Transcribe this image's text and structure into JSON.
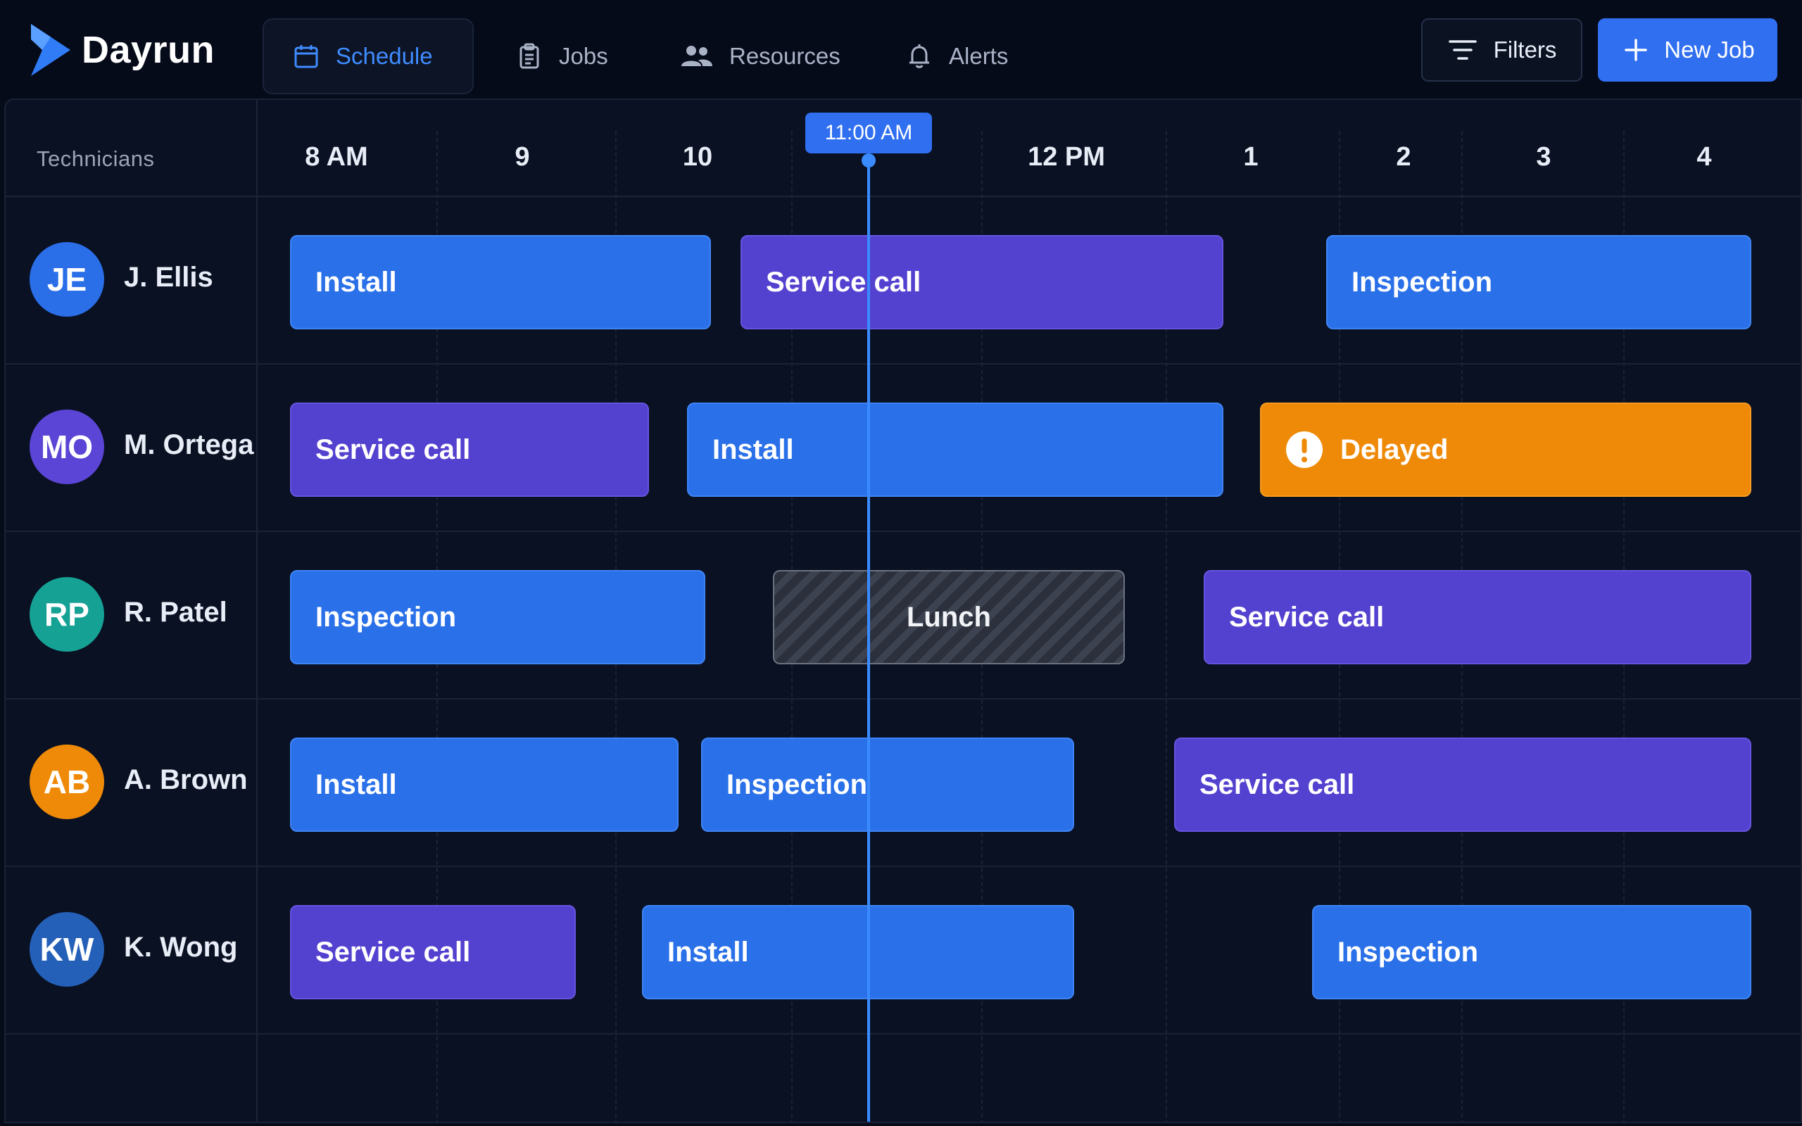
{
  "app": {
    "name": "Dayrun"
  },
  "nav": {
    "tabs": [
      {
        "label": "Schedule",
        "icon": "calendar-icon",
        "active": true
      },
      {
        "label": "Jobs",
        "icon": "clipboard-icon",
        "active": false
      },
      {
        "label": "Resources",
        "icon": "people-icon",
        "active": false
      },
      {
        "label": "Alerts",
        "icon": "bell-icon",
        "active": false
      }
    ]
  },
  "toolbar": {
    "filters_label": "Filters",
    "new_job_label": "New Job"
  },
  "schedule": {
    "column_header": "Technicians",
    "hours": [
      "8 AM",
      "9",
      "10",
      "12 PM",
      "1",
      "2",
      "3",
      "4"
    ],
    "current_time_label": "11:00 AM",
    "technicians": [
      {
        "initials": "JE",
        "name": "J. Ellis",
        "avatar_color": "#2a6ee8",
        "jobs": [
          {
            "label": "Install",
            "kind": "install"
          },
          {
            "label": "Service call",
            "kind": "service"
          },
          {
            "label": "Inspection",
            "kind": "inspection"
          }
        ]
      },
      {
        "initials": "MO",
        "name": "M. Ortega",
        "avatar_color": "#5b45d6",
        "jobs": [
          {
            "label": "Service call",
            "kind": "service"
          },
          {
            "label": "Install",
            "kind": "install"
          },
          {
            "label": "Delayed",
            "kind": "delayed",
            "icon": "alert-icon"
          }
        ]
      },
      {
        "initials": "RP",
        "name": "R. Patel",
        "avatar_color": "#16a195",
        "jobs": [
          {
            "label": "Inspection",
            "kind": "inspection"
          },
          {
            "label": "Lunch",
            "kind": "lunch"
          },
          {
            "label": "Service call",
            "kind": "service"
          }
        ]
      },
      {
        "initials": "AB",
        "name": "A. Brown",
        "avatar_color": "#ef8a08",
        "jobs": [
          {
            "label": "Install",
            "kind": "install"
          },
          {
            "label": "Inspection",
            "kind": "inspection"
          },
          {
            "label": "Service call",
            "kind": "service"
          }
        ]
      },
      {
        "initials": "KW",
        "name": "K. Wong",
        "avatar_color": "#2560b8",
        "jobs": [
          {
            "label": "Service call",
            "kind": "service"
          },
          {
            "label": "Install",
            "kind": "install"
          },
          {
            "label": "Inspection",
            "kind": "inspection"
          }
        ]
      }
    ]
  },
  "colors": {
    "accent": "#2f6ff0",
    "install": "#2a70e8",
    "service_call": "#5341cf",
    "delayed": "#ef8a08",
    "now_line": "#3a8bff"
  }
}
